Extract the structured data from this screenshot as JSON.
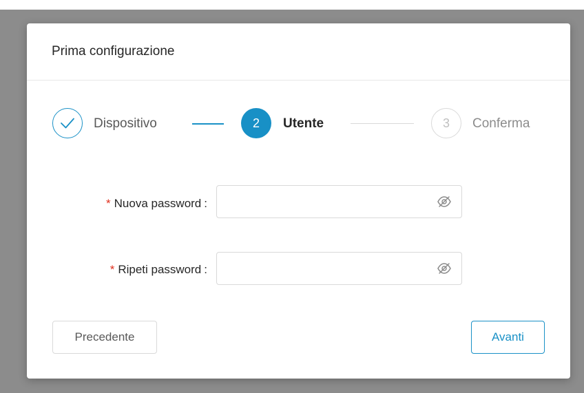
{
  "modal": {
    "title": "Prima configurazione"
  },
  "steps": [
    {
      "number": "✓",
      "label": "Dispositivo",
      "status": "completed"
    },
    {
      "number": "2",
      "label": "Utente",
      "status": "active"
    },
    {
      "number": "3",
      "label": "Conferma",
      "status": "pending"
    }
  ],
  "form": {
    "new_password": {
      "required_mark": "*",
      "label": "Nuova password",
      "colon": ":",
      "value": "",
      "icon": "eye-invisible-icon"
    },
    "repeat_password": {
      "required_mark": "*",
      "label": "Ripeti password",
      "colon": ":",
      "value": "",
      "icon": "eye-invisible-icon"
    }
  },
  "buttons": {
    "previous": "Precedente",
    "next": "Avanti"
  },
  "colors": {
    "primary": "#1890c6",
    "required": "#e0301e",
    "border": "#d9d9d9",
    "overlay": "#8c8c8c"
  }
}
